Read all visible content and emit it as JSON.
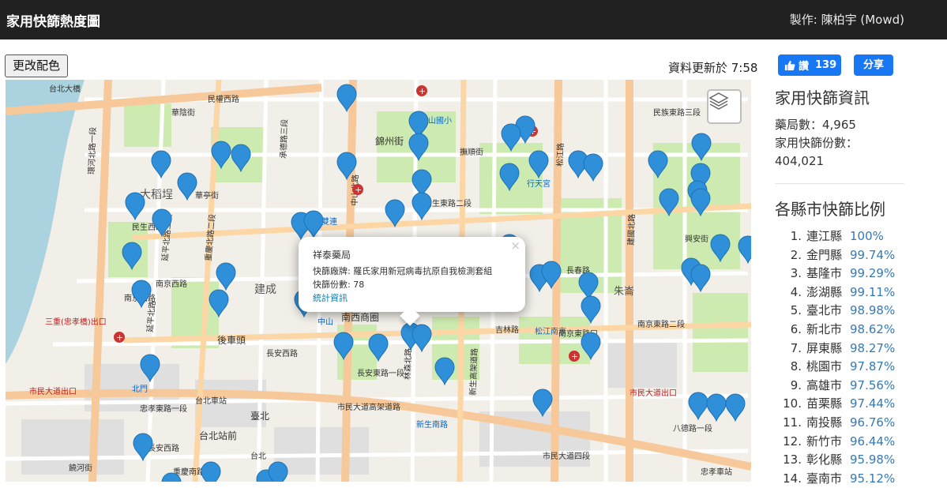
{
  "navbar": {
    "title": "家用快篩熱度圖",
    "author": "製作: 陳柏宇 (Mowd)"
  },
  "toolbar": {
    "change_color_label": "更改配色",
    "updated_text": "資料更新於 7:58"
  },
  "social": {
    "like_label": "讚",
    "like_count": "139",
    "share_label": "分享"
  },
  "map": {
    "labels": [
      "台北大橋",
      "環河北路一段",
      "大稻埕",
      "民生西路",
      "南京西路",
      "延平北路二段",
      "重慶北路二段",
      "建成",
      "後車頭",
      "三重(忠孝橋)出口",
      "市民大道出口",
      "台北車站",
      "北門",
      "台北站前",
      "承德路三段",
      "民權西路",
      "中山國小",
      "錦州街",
      "長安東路一段",
      "松江路",
      "行天宮",
      "朱崙",
      "南京東路二段",
      "市民大道高架道路",
      "忠孝東路一段",
      "建國北路",
      "臺北",
      "長安西路",
      "南西商圈",
      "雙連",
      "中山",
      "民族東路三段",
      "台北",
      "市民大道四段",
      "吉林路",
      "林森北路",
      "民生東路二段",
      "松江南京",
      "興安街",
      "八德路一段",
      "新生高架道路",
      "長春路",
      "中山北路",
      "撫順街",
      "重慶南路一段",
      "市民大道出口",
      "南京東路口",
      "忠孝車站",
      "新生南路",
      "饒河街",
      "華陰街",
      "長安西路",
      "南京西路",
      "延平北路",
      "華亭街"
    ],
    "accent_colors": {
      "marker": "#2f8fd8",
      "park": "#c8e8b0",
      "river": "#a9cbe8",
      "major_road": "#f4b87c"
    }
  },
  "popup": {
    "store": "祥泰藥局",
    "brand_line": "快篩廠牌: 羅氏家用新冠病毒抗原自我檢測套組",
    "count_line": "快篩份數: 78",
    "link": "統計資訊",
    "close": "×"
  },
  "sidebar": {
    "title": "家用快篩資訊",
    "pharmacies": "藥局數：4,965",
    "kits_label": "家用快篩份數：",
    "kits_value": "404,021",
    "ratio_title": "各縣市快篩比例",
    "ranks": [
      {
        "n": "1.",
        "name": "連江縣",
        "pct": "100%"
      },
      {
        "n": "2.",
        "name": "金門縣",
        "pct": "99.74%"
      },
      {
        "n": "3.",
        "name": "基隆市",
        "pct": "99.29%"
      },
      {
        "n": "4.",
        "name": "澎湖縣",
        "pct": "99.11%"
      },
      {
        "n": "5.",
        "name": "臺北市",
        "pct": "98.98%"
      },
      {
        "n": "6.",
        "name": "新北市",
        "pct": "98.62%"
      },
      {
        "n": "7.",
        "name": "屏東縣",
        "pct": "98.27%"
      },
      {
        "n": "8.",
        "name": "桃園市",
        "pct": "97.87%"
      },
      {
        "n": "9.",
        "name": "高雄市",
        "pct": "97.56%"
      },
      {
        "n": "10.",
        "name": "苗栗縣",
        "pct": "97.44%"
      },
      {
        "n": "11.",
        "name": "南投縣",
        "pct": "96.76%"
      },
      {
        "n": "12.",
        "name": "新竹市",
        "pct": "96.44%"
      },
      {
        "n": "13.",
        "name": "彰化縣",
        "pct": "95.98%"
      },
      {
        "n": "14.",
        "name": "臺南市",
        "pct": "95.12%"
      }
    ]
  }
}
